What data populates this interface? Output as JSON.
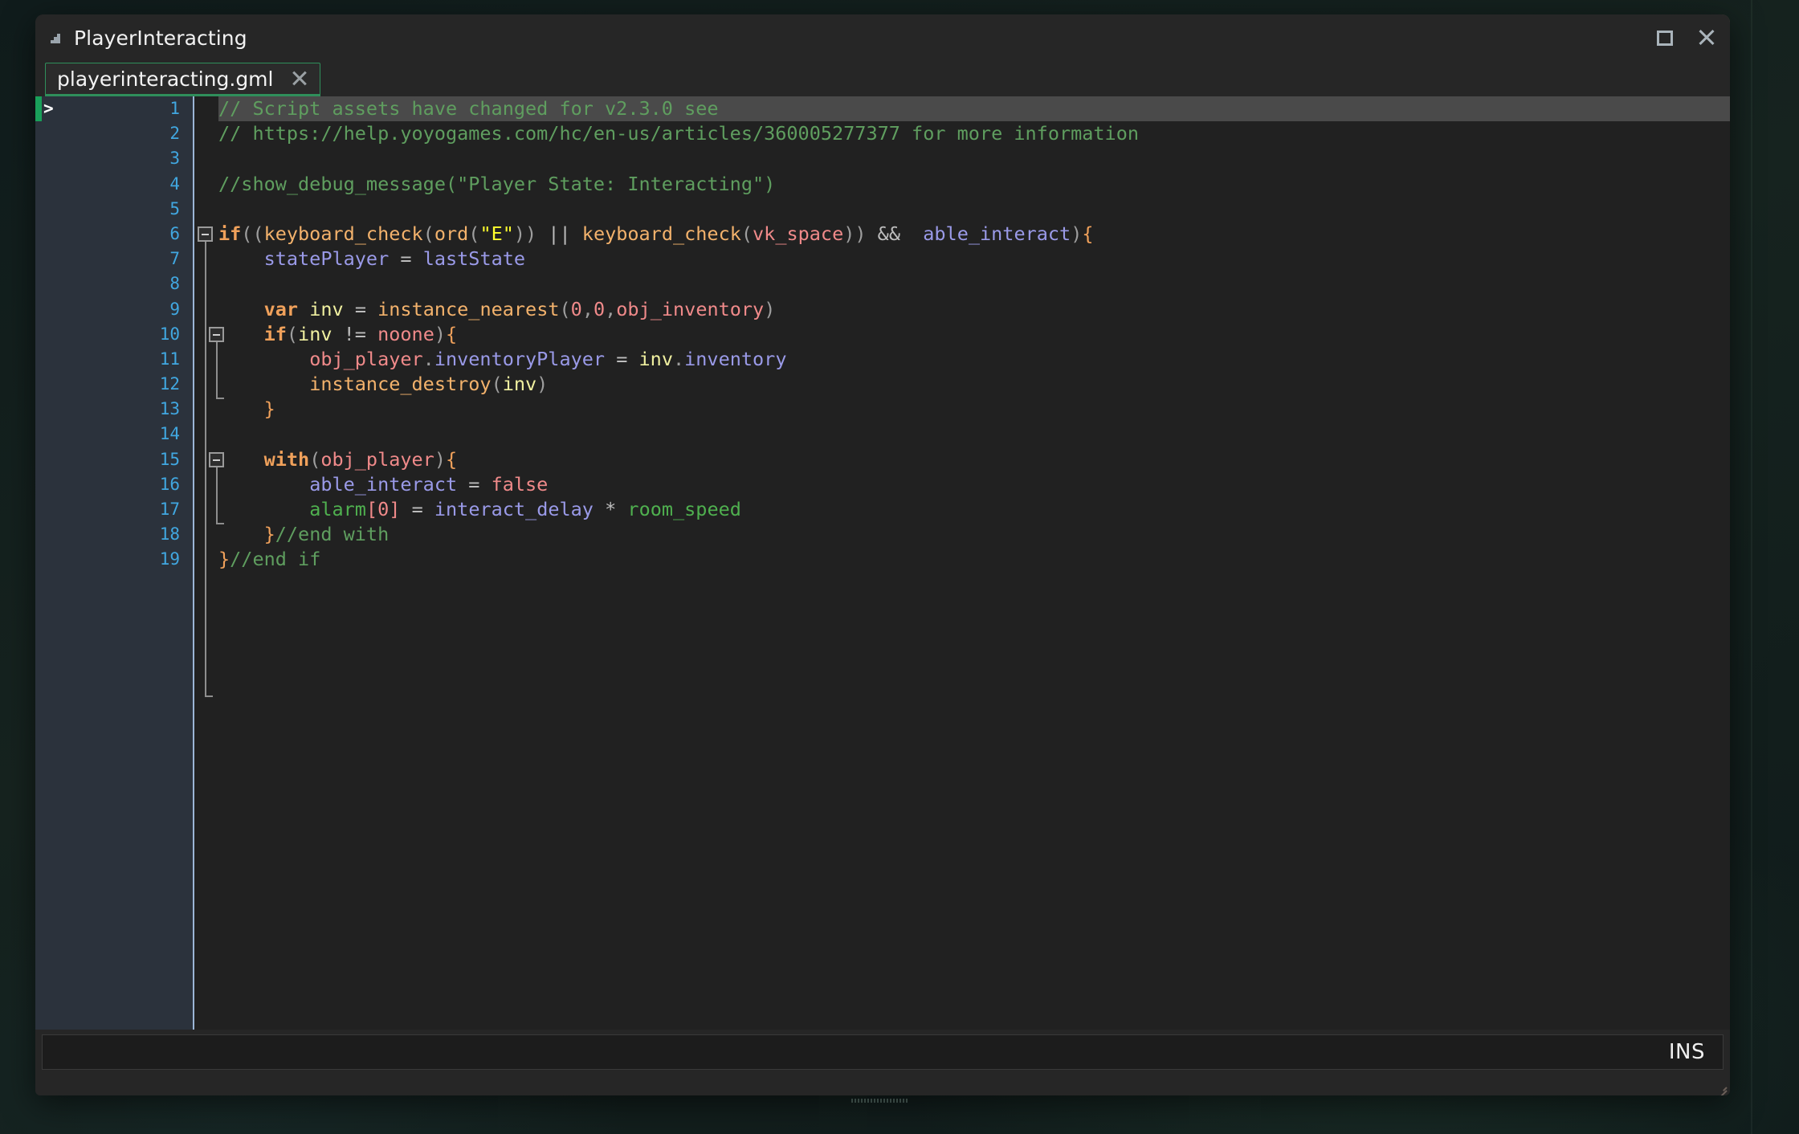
{
  "window": {
    "title": "PlayerInteracting",
    "icon": "app-triangle-icon",
    "controls": {
      "maximize_label": "Restore",
      "close_label": "Close"
    }
  },
  "tabs": [
    {
      "label": "playerinteracting.gml",
      "active": true,
      "close_label": "Close tab"
    }
  ],
  "editor": {
    "current_line": 1,
    "line_numbers": [
      "1",
      "2",
      "3",
      "4",
      "5",
      "6",
      "7",
      "8",
      "9",
      "10",
      "11",
      "12",
      "13",
      "14",
      "15",
      "16",
      "17",
      "18",
      "19"
    ],
    "lines": [
      {
        "n": 1,
        "text": "// Script assets have changed for v2.3.0 see"
      },
      {
        "n": 2,
        "text": "// https://help.yoyogames.com/hc/en-us/articles/360005277377 for more information"
      },
      {
        "n": 3,
        "text": ""
      },
      {
        "n": 4,
        "text": "//show_debug_message(\"Player State: Interacting\")"
      },
      {
        "n": 5,
        "text": ""
      },
      {
        "n": 6,
        "text": "if((keyboard_check(ord(\"E\")) || keyboard_check(vk_space)) &&  able_interact){"
      },
      {
        "n": 7,
        "text": "    statePlayer = lastState"
      },
      {
        "n": 8,
        "text": ""
      },
      {
        "n": 9,
        "text": "    var inv = instance_nearest(0,0,obj_inventory)"
      },
      {
        "n": 10,
        "text": "    if(inv != noone){"
      },
      {
        "n": 11,
        "text": "        obj_player.inventoryPlayer = inv.inventory"
      },
      {
        "n": 12,
        "text": "        instance_destroy(inv)"
      },
      {
        "n": 13,
        "text": "    }"
      },
      {
        "n": 14,
        "text": ""
      },
      {
        "n": 15,
        "text": "    with(obj_player){"
      },
      {
        "n": 16,
        "text": "        able_interact = false"
      },
      {
        "n": 17,
        "text": "        alarm[0] = interact_delay * room_speed"
      },
      {
        "n": 18,
        "text": "    }//end with"
      },
      {
        "n": 19,
        "text": "}//end if"
      }
    ],
    "caret_marker": ">"
  },
  "status_bar": {
    "insert_mode": "INS"
  },
  "colors": {
    "desktop": "#132020",
    "window_chrome": "#262626",
    "editor_bg": "#212121",
    "gutter_bg": "#2b323c",
    "line_number": "#41a7e0",
    "current_line_highlight": "#4a4a4a",
    "tab_accent": "#2f8f5b",
    "change_marker": "#19a05a",
    "comment": "#5f9e5f",
    "keyword": "#f0a15b",
    "function": "#f3b26c",
    "string": "#ffff2d",
    "constant": "#f08a8a",
    "variable": "#9a9ae8",
    "local_var": "#f0f0a0",
    "builtin": "#4fb04f",
    "operator": "#bdbdbd",
    "gutter_separator": "#9bb6d6"
  }
}
